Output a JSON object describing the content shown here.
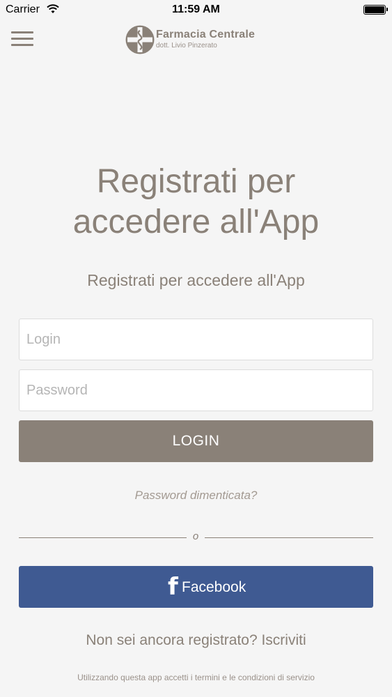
{
  "status_bar": {
    "carrier": "Carrier",
    "time": "11:59 AM"
  },
  "header": {
    "logo_title": "Farmacia Centrale",
    "logo_subtitle": "dott. Livio Pinzerato",
    "brand_color": "#8a8178"
  },
  "main": {
    "title_line1": "Registrati per",
    "title_line2": "accedere all'App",
    "subtitle": "Registrati per accedere all'App"
  },
  "form": {
    "login_placeholder": "Login",
    "login_value": "",
    "password_placeholder": "Password",
    "password_value": "",
    "login_button": "LOGIN",
    "forgot_password": "Password dimenticata?",
    "divider_text": "o"
  },
  "social": {
    "facebook_label": "Facebook",
    "facebook_icon": "facebook-icon",
    "facebook_color": "#3f5a92"
  },
  "footer": {
    "register_prompt": "Non sei ancora registrato? Iscriviti",
    "terms": "Utilizzando questa app accetti i termini e le condizioni di servizio"
  }
}
